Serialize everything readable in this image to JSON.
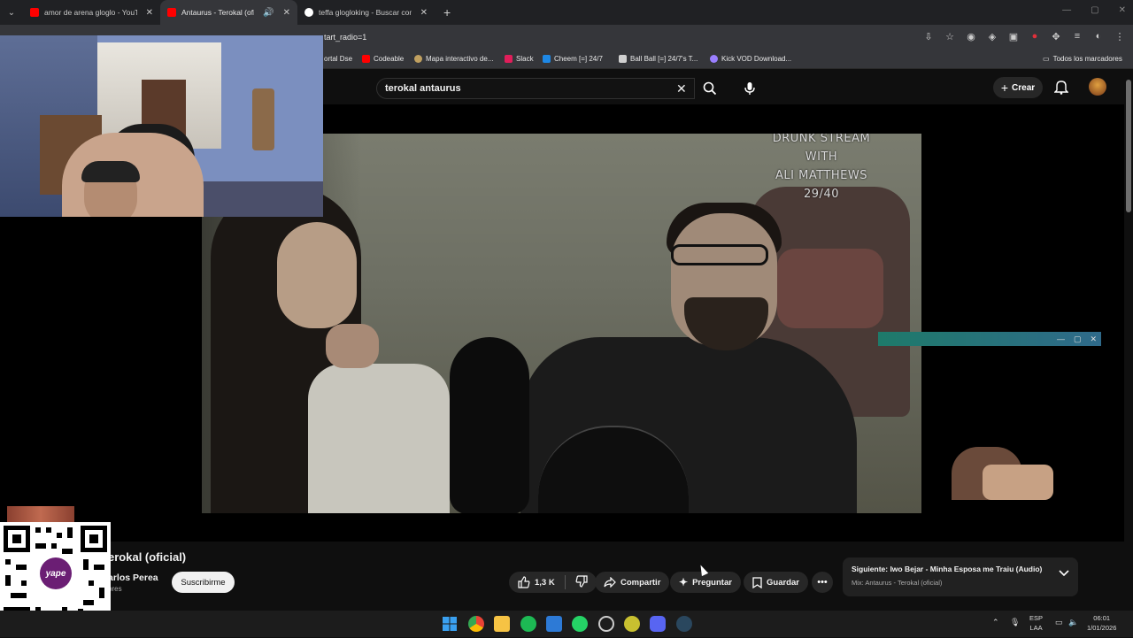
{
  "browser": {
    "tabs": [
      {
        "title": "amor de arena gloglo - YouTub",
        "favicon_color": "#ff0000"
      },
      {
        "title": "Antaurus - Terokal (oficial)",
        "favicon_color": "#ff0000"
      },
      {
        "title": "teffa glogloking - Buscar con G",
        "favicon_color": "#ffffff"
      }
    ],
    "url_visible": "tart_radio=1",
    "bookmarks": [
      {
        "label": "ortal Dse",
        "color": "#4a6fd0"
      },
      {
        "label": "Codeable",
        "color": "#ff0000"
      },
      {
        "label": "Mapa interactivo de...",
        "color": "#c0a060"
      },
      {
        "label": "Slack",
        "color": "#e01e5a"
      },
      {
        "label": "Cheem [=] 24/7",
        "color": "#1e88e5"
      },
      {
        "label": "Ball Ball [=] 24/7's T...",
        "color": "#d0d0d0"
      },
      {
        "label": "Kick VOD Download...",
        "color": "#9a7fff"
      }
    ],
    "all_bookmarks": "Todos los marcadores"
  },
  "youtube": {
    "search_value": "terokal antaurus",
    "create_label": "Crear",
    "video_overlay_lines": [
      "DRUNK STREAM WITH",
      "ALI MATTHEWS",
      "29/40"
    ],
    "video_title": "erokal (oficial)",
    "channel_name": "arlos Perea",
    "channel_subs": "ores",
    "subscribe_label": "Suscribirme",
    "like_count": "1,3 K",
    "share_label": "Compartir",
    "ask_label": "Preguntar",
    "save_label": "Guardar",
    "next_up": {
      "title": "Siguiente: Iwo Bejar - Minha Esposa me Traiu (Audio)",
      "subtitle": "Mix: Antaurus - Terokal (oficial)"
    }
  },
  "qr": {
    "brand": "yape"
  },
  "taskbar": {
    "lang_top": "ESP",
    "lang_bottom": "LAA",
    "time": "06:01",
    "date": "1/01/2026"
  }
}
